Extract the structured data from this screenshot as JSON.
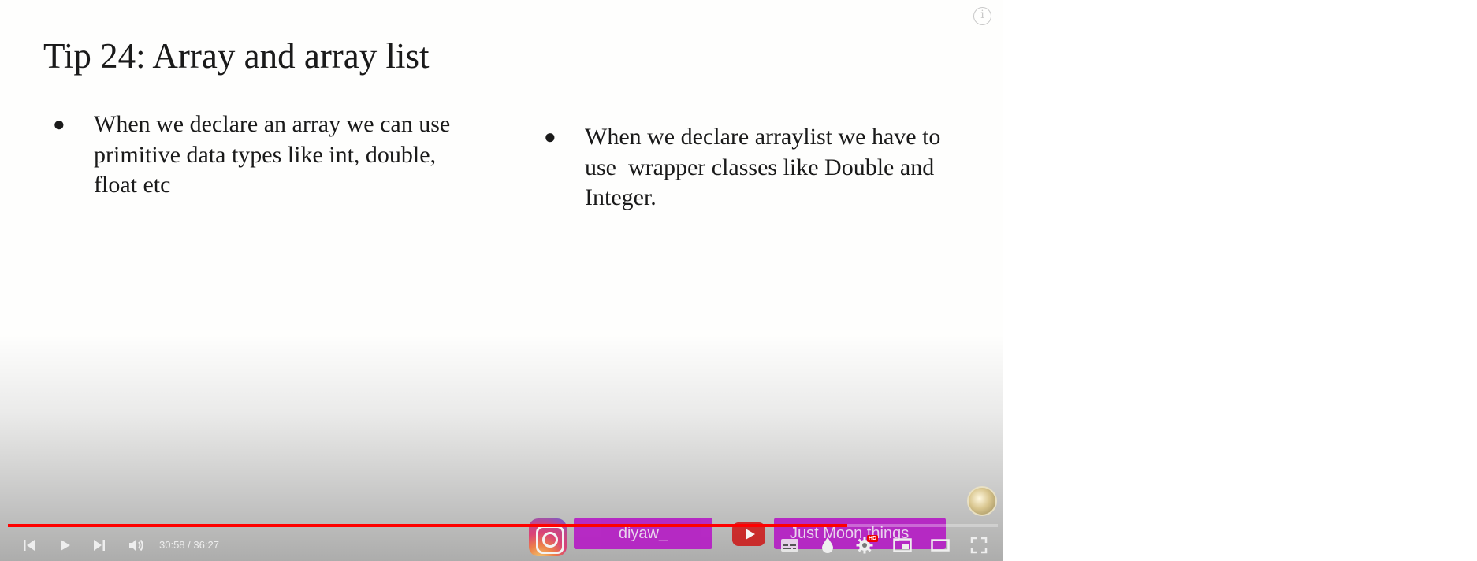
{
  "slide": {
    "title": "Tip 24: Array and array list",
    "bullet_glyph": "●",
    "bullets": [
      {
        "line1": "When we declare an array we can use",
        "line2": "primitive data types like int, double,",
        "line3": "float etc"
      },
      {
        "line1": "When we declare arraylist we have to",
        "line2": "use  wrapper classes like Double and",
        "line3": "Integer."
      }
    ]
  },
  "player": {
    "info_glyph": "i",
    "progress_fraction": 0.848,
    "progress_color": "#ff0000",
    "time": {
      "current": "30:58",
      "separator": " / ",
      "duration": "36:27"
    },
    "controls": {
      "previous_icon": "skip-previous-icon",
      "play_icon": "play-icon",
      "next_icon": "skip-next-icon",
      "volume_icon": "volume-icon",
      "subtitles_icon": "subtitles-icon",
      "ambient_icon": "ambient-mode-icon",
      "settings_icon": "settings-gear-icon",
      "settings_badge": "HD",
      "miniplayer_icon": "miniplayer-icon",
      "theater_icon": "theater-mode-icon",
      "fullscreen_icon": "fullscreen-icon"
    }
  },
  "overlay": {
    "instagram": {
      "icon": "instagram-icon",
      "label": "diyaw_",
      "color": "#b522c4"
    },
    "youtube": {
      "icon": "youtube-icon",
      "label": "Just Moon things",
      "color": "#b522c4"
    },
    "channel_logo": "moon-logo"
  }
}
